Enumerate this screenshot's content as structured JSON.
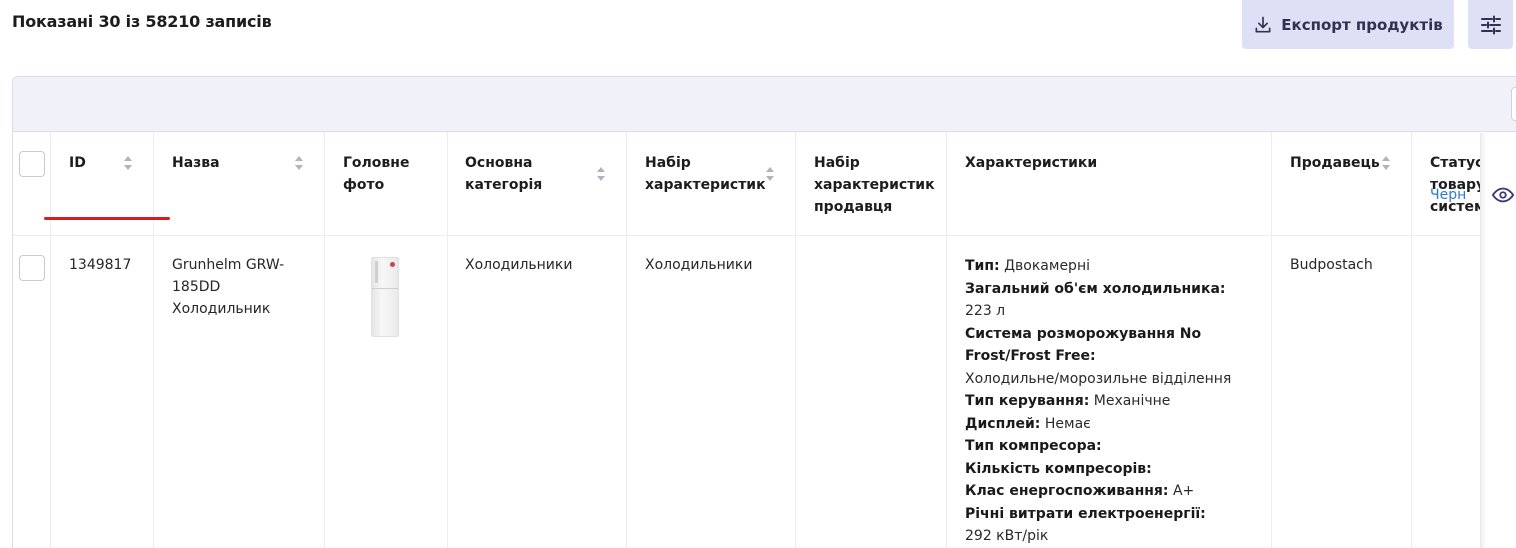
{
  "header": {
    "records_count": "Показані 30 із 58210 записів",
    "export_label": "Експорт продуктів"
  },
  "columns": {
    "id": "ID",
    "name": "Назва",
    "photo_line1": "Головне",
    "photo_line2": "фото",
    "category_line1": "Основна",
    "category_line2": "категорія",
    "charset_line1": "Набір",
    "charset_line2": "характеристик",
    "seller_charset_line1": "Набір",
    "seller_charset_line2": "характеристик",
    "seller_charset_line3": "продавця",
    "characteristics": "Характеристики",
    "seller": "Продавець",
    "status_line1": "Статус",
    "status_line2": "товару",
    "status_line3": "систем"
  },
  "row": {
    "id": "1349817",
    "name_line1": "Grunhelm GRW-",
    "name_line2": "185DD",
    "name_line3": "Холодильник",
    "category": "Холодильники",
    "charset": "Холодильники",
    "seller": "Budpostach",
    "status": "Черн",
    "specs": [
      {
        "label": "Тип:",
        "value": " Двокамерні"
      },
      {
        "label": "Загальний об'єм холодильника:",
        "value": ""
      },
      {
        "label": "",
        "value": "223 л"
      },
      {
        "label": "Система розморожування No",
        "value": ""
      },
      {
        "label": "Frost/Frost Free:",
        "value": ""
      },
      {
        "label": "",
        "value": "Холодильне/морозильне відділення"
      },
      {
        "label": "Тип керування:",
        "value": " Механічне"
      },
      {
        "label": "Дисплей:",
        "value": " Немає"
      },
      {
        "label": "Тип компресора:",
        "value": ""
      },
      {
        "label": "Кількість компресорів:",
        "value": ""
      },
      {
        "label": "Клас енергоспоживання:",
        "value": " A+"
      },
      {
        "label": "Річні витрати електроенергії:",
        "value": ""
      },
      {
        "label": "",
        "value": "292 кВт/рік"
      }
    ]
  },
  "icons": {
    "export": "download-icon",
    "settings": "sliders-icon",
    "view": "eye-icon",
    "sort": "sort-arrows-icon"
  },
  "colors": {
    "button_bg": "#dee0f6",
    "link": "#2d7bc9",
    "annotation": "#d91d1d"
  }
}
